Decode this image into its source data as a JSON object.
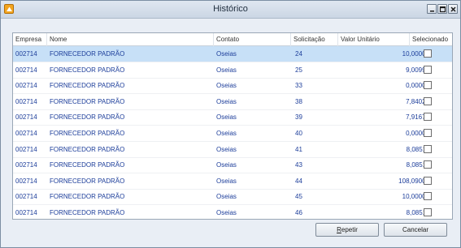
{
  "window": {
    "title": "Histórico"
  },
  "grid": {
    "columns": {
      "empresa": "Empresa",
      "nome": "Nome",
      "contato": "Contato",
      "solicitacao": "Solicitação",
      "valor": "Valor Unitário",
      "selecionado": "Selecionado"
    },
    "rows": [
      {
        "empresa": "002714",
        "nome": "FORNECEDOR PADRÃO",
        "contato": "Oseias",
        "solicitacao": "24",
        "valor": "10,00000",
        "selecionado": false
      },
      {
        "empresa": "002714",
        "nome": "FORNECEDOR PADRÃO",
        "contato": "Oseias",
        "solicitacao": "25",
        "valor": "9,00990",
        "selecionado": false
      },
      {
        "empresa": "002714",
        "nome": "FORNECEDOR PADRÃO",
        "contato": "Oseias",
        "solicitacao": "33",
        "valor": "0,00000",
        "selecionado": false
      },
      {
        "empresa": "002714",
        "nome": "FORNECEDOR PADRÃO",
        "contato": "Oseias",
        "solicitacao": "38",
        "valor": "7,84023",
        "selecionado": false
      },
      {
        "empresa": "002714",
        "nome": "FORNECEDOR PADRÃO",
        "contato": "Oseias",
        "solicitacao": "39",
        "valor": "7,91673",
        "selecionado": false
      },
      {
        "empresa": "002714",
        "nome": "FORNECEDOR PADRÃO",
        "contato": "Oseias",
        "solicitacao": "40",
        "valor": "0,00000",
        "selecionado": false
      },
      {
        "empresa": "002714",
        "nome": "FORNECEDOR PADRÃO",
        "contato": "Oseias",
        "solicitacao": "41",
        "valor": "8,08511",
        "selecionado": false
      },
      {
        "empresa": "002714",
        "nome": "FORNECEDOR PADRÃO",
        "contato": "Oseias",
        "solicitacao": "43",
        "valor": "8,08511",
        "selecionado": false
      },
      {
        "empresa": "002714",
        "nome": "FORNECEDOR PADRÃO",
        "contato": "Oseias",
        "solicitacao": "44",
        "valor": "108,09000",
        "selecionado": false
      },
      {
        "empresa": "002714",
        "nome": "FORNECEDOR PADRÃO",
        "contato": "Oseias",
        "solicitacao": "45",
        "valor": "10,00000",
        "selecionado": false
      },
      {
        "empresa": "002714",
        "nome": "FORNECEDOR PADRÃO",
        "contato": "Oseias",
        "solicitacao": "46",
        "valor": "8,08511",
        "selecionado": false
      }
    ],
    "selected_row_index": 0
  },
  "buttons": {
    "repetir_first": "R",
    "repetir_rest": "epetir",
    "cancelar": "Cancelar"
  },
  "colors": {
    "row_text": "#1c3d9a",
    "selected_row": "#c7e0f7"
  }
}
